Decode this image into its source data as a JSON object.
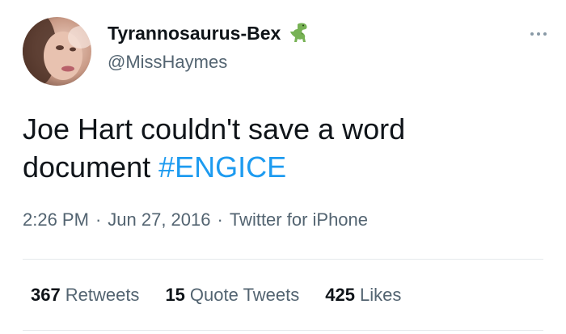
{
  "tweet": {
    "author": {
      "display_name": "Tyrannosaurus-Bex",
      "handle": "@MissHaymes",
      "name_emoji_icon": "t-rex-emoji"
    },
    "text_main": "Joe Hart couldn't save a word document ",
    "hashtag": "#ENGICE",
    "time": "2:26 PM",
    "separator": "·",
    "date": "Jun 27, 2016",
    "source": "Twitter for iPhone",
    "stats": {
      "retweets_count": "367",
      "retweets_label": "Retweets",
      "quote_tweets_count": "15",
      "quote_tweets_label": "Quote Tweets",
      "likes_count": "425",
      "likes_label": "Likes"
    },
    "more_icon": "more-options-icon"
  },
  "colors": {
    "text_primary": "#0f1419",
    "text_secondary": "#536471",
    "accent": "#1d9bf0",
    "divider": "#e5e9ec"
  }
}
